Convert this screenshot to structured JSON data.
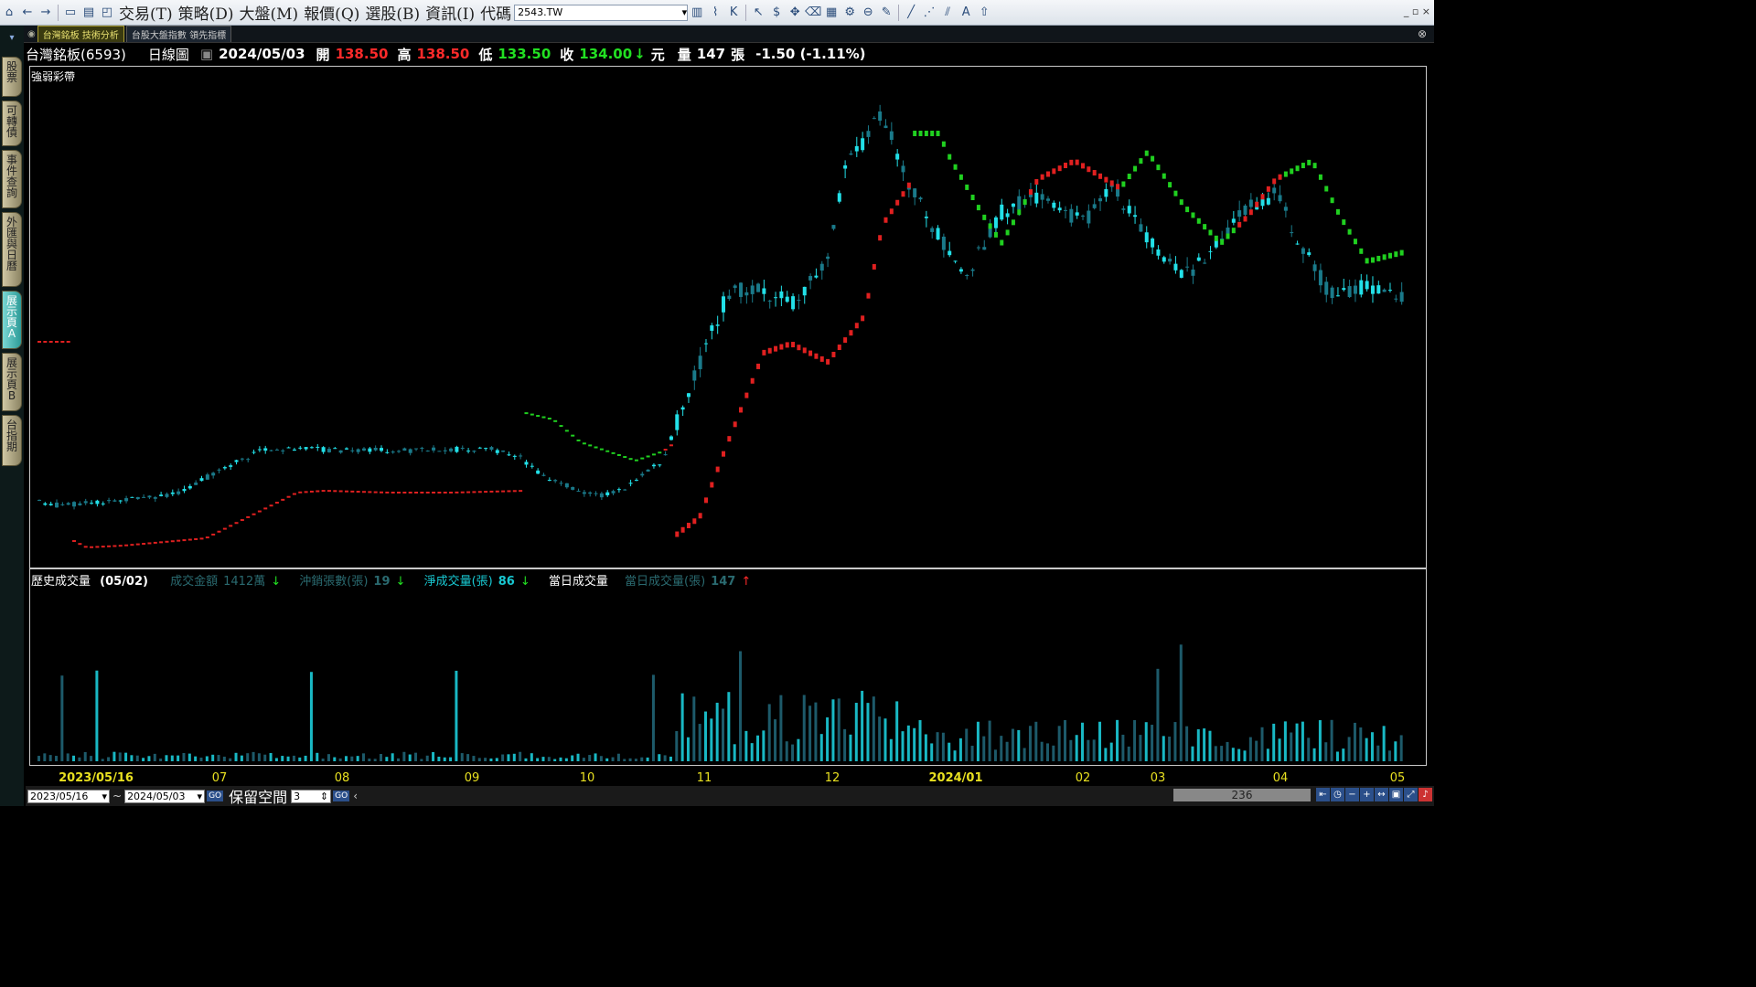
{
  "toolbar": {
    "menus": [
      "交易(T)",
      "策略(D)",
      "大盤(M)",
      "報價(Q)",
      "選股(B)",
      "資訊(I)"
    ],
    "code_label": "代碼",
    "code_value": "2543.TW"
  },
  "sidebar": {
    "tabs": [
      "股票",
      "可轉債",
      "事件查詢",
      "外匯與日曆",
      "展示頁A",
      "展示頁B",
      "台指期"
    ],
    "active": "展示頁A"
  },
  "tabs": [
    "台灣銘板 技術分析",
    "台股大盤指數 領先指標"
  ],
  "info": {
    "name": "台灣銘板(6593)",
    "period": "日線圖",
    "date": "2024/05/03",
    "open_label": "開",
    "open": "138.50",
    "high_label": "高",
    "high": "138.50",
    "low_label": "低",
    "low": "133.50",
    "close_label": "收",
    "close": "134.00",
    "unit": "元",
    "vol_label": "量",
    "vol": "147",
    "vol_unit": "張",
    "change": "-1.50 (-1.11%)"
  },
  "price_panel": {
    "title": "強弱彩帶"
  },
  "volume_panel": {
    "title": "歷史成交量",
    "date": "(05/02)",
    "amount_label": "成交金額",
    "amount": "1412萬",
    "daytrade_label": "沖銷張數(張)",
    "daytrade": "19",
    "net_label": "淨成交量(張)",
    "net": "86",
    "today_label": "當日成交量",
    "today_vol_label": "當日成交量(張)",
    "today_vol": "147"
  },
  "xaxis": {
    "labels": [
      "2023/05/16",
      "07",
      "08",
      "09",
      "10",
      "11",
      "12",
      "2024/01",
      "02",
      "03",
      "04",
      "05"
    ]
  },
  "status": {
    "start": "2023/05/16",
    "end": "2024/05/03",
    "reserve_label": "保留空間",
    "reserve": "3",
    "bars": "236"
  },
  "colors": {
    "up": "#22e0e8",
    "down": "#1a7a8a",
    "band_up": "#e02020",
    "band_down": "#20d020",
    "axis": "#e8e020"
  }
}
